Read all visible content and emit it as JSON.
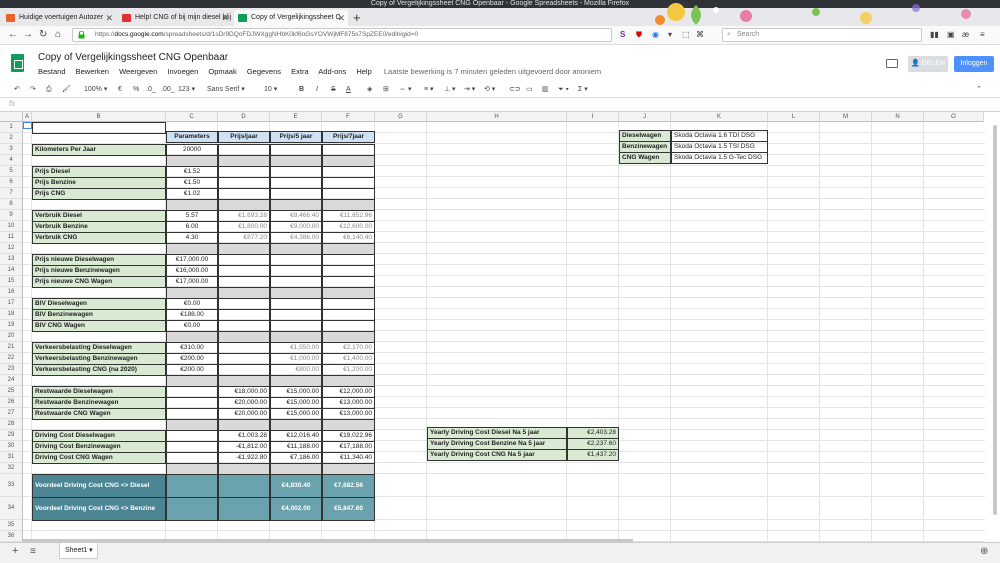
{
  "window_title": "Copy of Vergelijkingssheet CNG Openbaar - Google Spreadsheets - Mozilla Firefox",
  "browser": {
    "tabs": [
      {
        "label": "Huidige voertuigen Autozer",
        "color": "#e8632b"
      },
      {
        "label": "Help! CNG of bij mijn diesel blij",
        "color": "#dd3333"
      },
      {
        "label": "Copy of Vergelijkingssheet C",
        "color": "#0f9d58"
      }
    ],
    "url_domain": "docs.google.com",
    "url_prefix": "https://",
    "url_path": "/spreadsheets/d/1sDr9DQoFDJWXggNHbK0kf6oGsYOVWjMF875s7SpZEE0/edit#gid=0",
    "search_placeholder": "Search"
  },
  "doc": {
    "title": "Copy of Vergelijkingssheet CNG Openbaar",
    "menus": [
      "Bestand",
      "Bewerken",
      "Weergeven",
      "Invoegen",
      "Opmaak",
      "Gegevens",
      "Extra",
      "Add-ons",
      "Help"
    ],
    "last_edit": "Laatste bewerking is 7 minuten geleden uitgevoerd door anoniem",
    "share_label": "DELEN",
    "login_label": "Inloggen"
  },
  "toolbar": {
    "zoom": "100%",
    "currency": "€",
    "percent": "%",
    "dec_less": ".0_",
    "dec_more": ".00_",
    "format": "123",
    "font": "Sans Serif",
    "size": "10"
  },
  "formula_bar": {
    "fx": "fx"
  },
  "columns": [
    "A",
    "B",
    "C",
    "D",
    "E",
    "F",
    "G",
    "H",
    "I",
    "J",
    "K",
    "L",
    "M",
    "N",
    "O"
  ],
  "rows": [
    "1",
    "2",
    "3",
    "4",
    "5",
    "6",
    "7",
    "8",
    "9",
    "10",
    "11",
    "12",
    "13",
    "14",
    "15",
    "16",
    "17",
    "18",
    "19",
    "20",
    "21",
    "22",
    "23",
    "24",
    "25",
    "26",
    "27",
    "28",
    "29",
    "30",
    "31",
    "32",
    "33",
    "34",
    "35",
    "36"
  ],
  "headers": {
    "c": "Parameters",
    "d": "Prijs/jaar",
    "e": "Prijs/5 jaar",
    "f": "Prijs/7jaar"
  },
  "table": {
    "r3": {
      "b": "Kilometers Per Jaar",
      "c": "20000"
    },
    "r5": {
      "b": "Prijs Diesel",
      "c": "€1.52"
    },
    "r6": {
      "b": "Prijs Benzine",
      "c": "€1.50"
    },
    "r7": {
      "b": "Prijs CNG",
      "c": "€1.02"
    },
    "r9": {
      "b": "Verbruik Diesel",
      "c": "5.57",
      "d": "€1,693.28",
      "e": "€8,466.40",
      "f": "€11,852.96"
    },
    "r10": {
      "b": "Verbruik Benzine",
      "c": "6.00",
      "d": "€1,800.00",
      "e": "€9,000.00",
      "f": "€12,600.00"
    },
    "r11": {
      "b": "Verbruik CNG",
      "c": "4.30",
      "d": "€877.20",
      "e": "€4,386.00",
      "f": "€6,140.40"
    },
    "r13": {
      "b": "Prijs nieuwe Dieselwagen",
      "c": "€17,000.00"
    },
    "r14": {
      "b": "Prijs nieuwe Benzinewagen",
      "c": "€16,000.00"
    },
    "r15": {
      "b": "Prijs nieuwe CNG Wagen",
      "c": "€17,000.00"
    },
    "r17": {
      "b": "BIV Dieselwagen",
      "c": "€0.00"
    },
    "r18": {
      "b": "BIV Benzinewagen",
      "c": "€188.00"
    },
    "r19": {
      "b": "BIV CNG Wagen",
      "c": "€0.00"
    },
    "r21": {
      "b": "Verkeersbelasting Dieselwagen",
      "c": "€310.00",
      "e": "€1,550.00",
      "f": "€2,170.00"
    },
    "r22": {
      "b": "Verkeersbelasting Benzinewagen",
      "c": "€200.00",
      "e": "€1,000.00",
      "f": "€1,400.00"
    },
    "r23": {
      "b": "Verkeersbelasting CNG (na 2020)",
      "c": "€200.00",
      "e": "€800.00",
      "f": "€1,200.00"
    },
    "r25": {
      "b": "Restwaarde Dieselwagen",
      "d": "€18,000.00",
      "e": "€15,000.00",
      "f": "€12,000.00"
    },
    "r26": {
      "b": "Restwaarde Benzinewagen",
      "d": "€20,000.00",
      "e": "€15,000.00",
      "f": "€13,000.00"
    },
    "r27": {
      "b": "Restwaarde CNG Wagen",
      "d": "€20,000.00",
      "e": "€15,000.00",
      "f": "€13,000.00"
    },
    "r29": {
      "b": "Driving Cost Dieselwagen",
      "d": "€1,003.28",
      "e": "€12,016.40",
      "f": "€19,022.96"
    },
    "r30": {
      "b": "Driving Cost Benzinewagen",
      "d": "-€1,812.00",
      "e": "€11,188.00",
      "f": "€17,188.00"
    },
    "r31": {
      "b": "Driving Cost CNG Wagen",
      "d": "-€1,922.80",
      "e": "€7,186.00",
      "f": "€11,340.40"
    },
    "r33": {
      "b": "Voordeel Driving Cost CNG <> Diesel",
      "e": "€4,830.40",
      "f": "€7,682.56"
    },
    "r34": {
      "b": "Voordeel Driving Cost CNG <> Benzine",
      "e": "€4,002.00",
      "f": "€5,847.60"
    }
  },
  "yearly": [
    {
      "label": "Yearly Driving Cost Diesel Na 5 jaar",
      "value": "€2,403.28"
    },
    {
      "label": "Yearly Driving Cost Benzine Na 5 jaar",
      "value": "€2,237.60"
    },
    {
      "label": "Yearly Driving Cost CNG Na 5 jaar",
      "value": "€1,437.20"
    }
  ],
  "cars": [
    {
      "label": "Dieselwagen",
      "value": "Skoda Octavia 1.6 TDI DSG"
    },
    {
      "label": "Benzinewagen",
      "value": "Skoda Octavia 1.5 TSI DSG"
    },
    {
      "label": "CNG Wagen",
      "value": "Skoda Octavia 1.5 G-Tec DSG"
    }
  ],
  "sheet_tabs": {
    "add": "+",
    "list": "≡",
    "active": "Sheet1"
  },
  "colors": {
    "accent": "#4d90fe",
    "sheets_green": "#0f9d58",
    "teal": "#6aa2ad"
  }
}
